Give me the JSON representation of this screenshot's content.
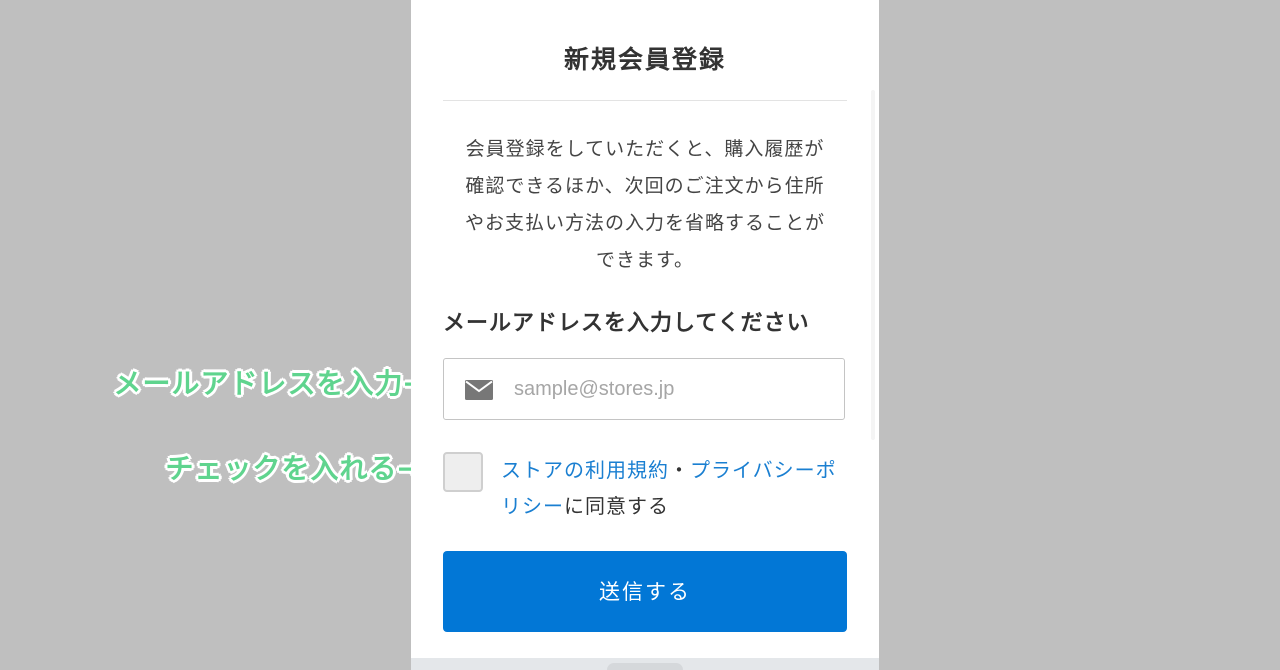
{
  "page": {
    "title": "新規会員登録",
    "description_lines": [
      "会員登録をしていただくと、購入履歴が",
      "確認できるほか、次回のご注文から住所",
      "やお支払い方法の入力を省略することが",
      "できます。"
    ]
  },
  "email": {
    "heading": "メールアドレスを入力してください",
    "placeholder": "sample@stores.jp",
    "value": ""
  },
  "agreement": {
    "terms_link": "ストアの利用規約",
    "separator": "・",
    "privacy_link": "プライバシーポリシー",
    "suffix": "に同意する",
    "checked": false
  },
  "submit": {
    "label": "送信する"
  },
  "annotations": {
    "email": "メールアドレスを入力→",
    "checkbox": "チェックを入れる→"
  },
  "colors": {
    "primary": "#0277d6",
    "link": "#1a7fd1",
    "annotation": "#5fd48e",
    "backdrop": "#bfbfbf"
  },
  "icons": {
    "email_field": "mail-icon"
  }
}
